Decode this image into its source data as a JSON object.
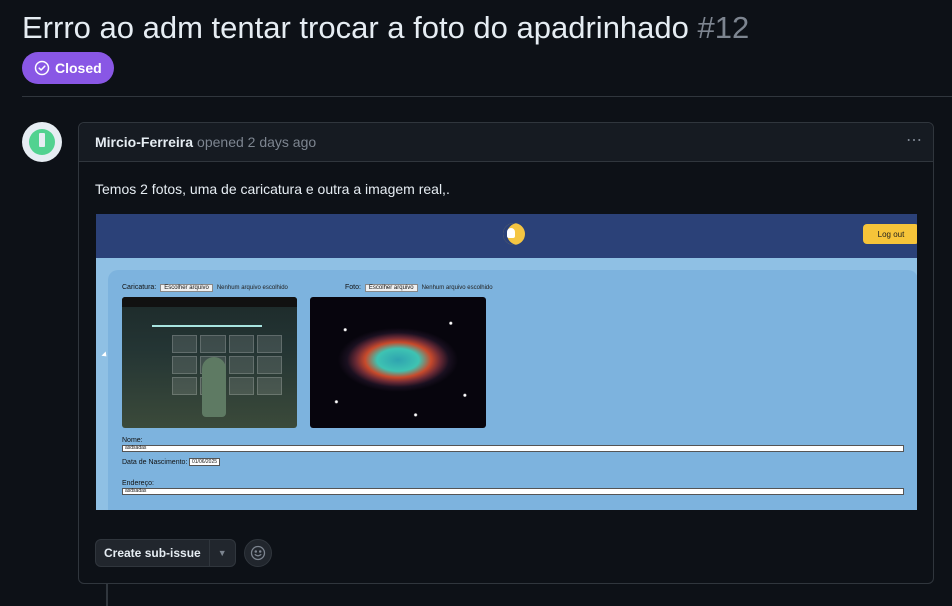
{
  "issue": {
    "title": "Errro ao adm tentar trocar a foto do apadrinhado",
    "number": "#12",
    "status": "Closed"
  },
  "comment": {
    "author": "Mircio-Ferreira",
    "meta": "opened 2 days ago",
    "body": "Temos 2 fotos, uma de caricatura e outra a imagem real,."
  },
  "embedded_screenshot": {
    "logout_label": "Log out",
    "caricatura_label": "Caricatura:",
    "foto_label": "Foto:",
    "choose_file_label": "Escolher arquivo",
    "no_file_label": "Nenhum arquivo escolhido",
    "nome_label": "Nome:",
    "nome_value": "asdsadas",
    "nascimento_label": "Data de Nascimento:",
    "nascimento_value": "01/06/2025",
    "endereco_label": "Endereço:",
    "endereco_value": "asdsadas"
  },
  "actions": {
    "create_sub_issue": "Create sub-issue"
  },
  "colors": {
    "background": "#0d1117",
    "closed_badge": "#8957e5",
    "border": "#30363d",
    "muted_text": "#7d8590"
  },
  "icons": [
    "closed-circle-icon",
    "kebab-icon",
    "caret-down-icon",
    "smiley-icon"
  ]
}
